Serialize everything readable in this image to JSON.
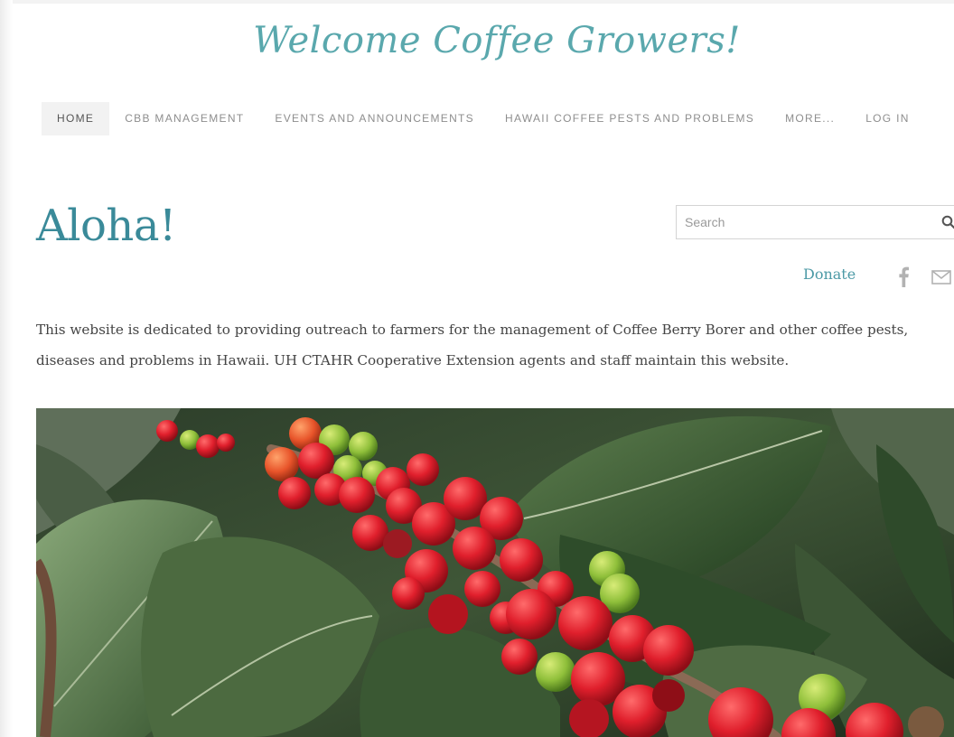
{
  "header": {
    "site_title": "Welcome Coffee Growers!"
  },
  "nav": {
    "items": [
      {
        "label": "HOME",
        "active": true
      },
      {
        "label": "CBB MANAGEMENT",
        "active": false
      },
      {
        "label": "EVENTS AND ANNOUNCEMENTS",
        "active": false
      },
      {
        "label": "HAWAII COFFEE PESTS AND PROBLEMS",
        "active": false
      },
      {
        "label": "MORE...",
        "active": false
      },
      {
        "label": "LOG IN",
        "active": false
      }
    ]
  },
  "main": {
    "heading": "Aloha!",
    "intro_text": "This website is dedicated to providing outreach to farmers for the management of Coffee Berry Borer and other coffee pests, diseases and problems in Hawaii. UH CTAHR Cooperative Extension agents and staff maintain this website.",
    "hero_image_icon": "coffee-cherries-photo"
  },
  "search": {
    "placeholder": "Search",
    "value": "",
    "icon": "search-icon"
  },
  "sidebar": {
    "donate_label": "Donate",
    "social_icons": [
      "facebook-icon",
      "mail-icon"
    ]
  },
  "colors": {
    "title": "#5aa8ad",
    "heading": "#3a8a99",
    "link": "#4c9aa6",
    "nav_text": "#8e8e8e",
    "nav_active_bg": "#f2f2f2",
    "body_text": "#444444"
  }
}
